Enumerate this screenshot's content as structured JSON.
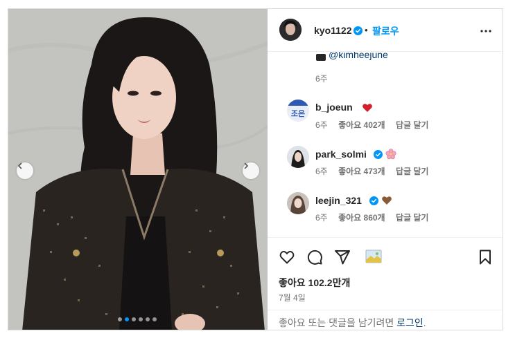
{
  "post": {
    "author": "kyo1122",
    "separator": "•",
    "follow_label": "팔로우",
    "partial_comment": {
      "mention": "@kimheejune",
      "time": "6주"
    },
    "comments": [
      {
        "username": "b_joeun",
        "emoji": "red-heart-icon",
        "time": "6주",
        "likes": "좋아요 402개",
        "reply": "답글 달기",
        "verified": false,
        "avatar_text": "조은"
      },
      {
        "username": "park_solmi",
        "emoji": "cherry-blossom-icon",
        "time": "6주",
        "likes": "좋아요 473개",
        "reply": "답글 달기",
        "verified": true
      },
      {
        "username": "leejin_321",
        "emoji": "brown-heart-icon",
        "time": "6주",
        "likes": "좋아요 860개",
        "reply": "답글 달기",
        "verified": true
      }
    ],
    "like_count": "좋아요 102.2만개",
    "date": "7월 4일",
    "login_prompt": "좋아요 또는 댓글을 남기려면",
    "login_link": "로그인",
    "login_suffix": ".",
    "carousel": {
      "total": 6,
      "active": 1
    },
    "colors": {
      "accent": "#0095f6",
      "verified": "#0095f6",
      "link": "#00376b",
      "muted": "#737373"
    }
  }
}
